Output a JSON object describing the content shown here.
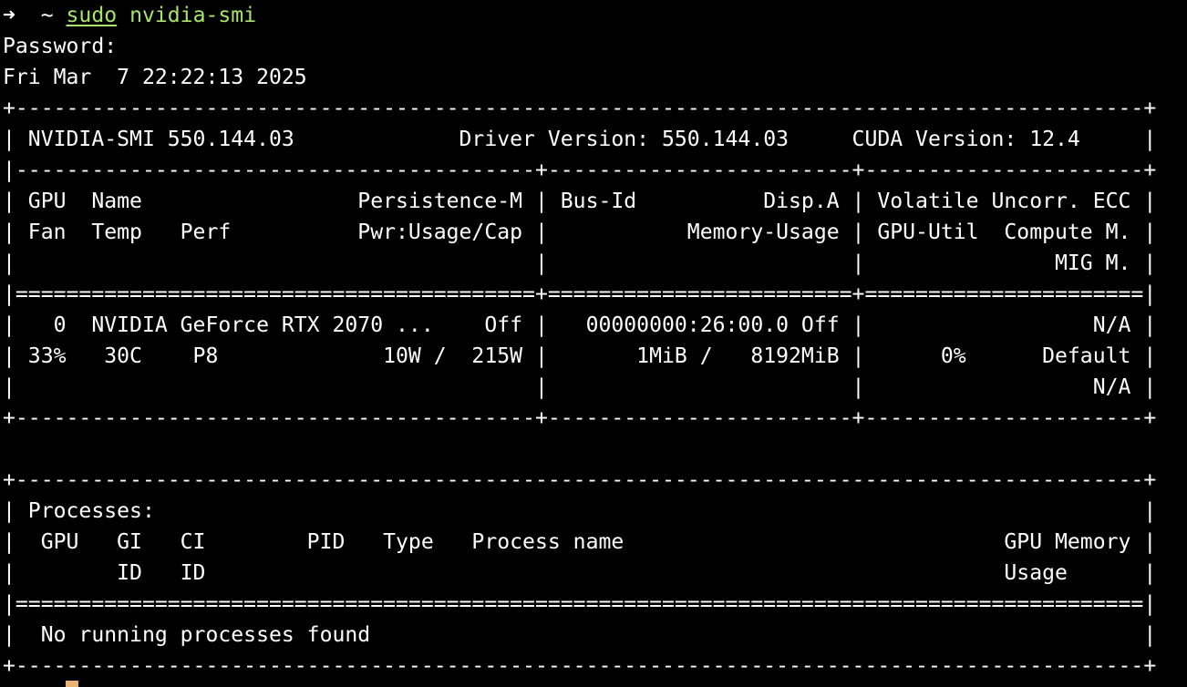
{
  "prompt": {
    "arrow": "➜",
    "dir": "~",
    "sudo": "sudo",
    "command": "nvidia-smi"
  },
  "output": [
    "Password:",
    "Fri Mar  7 22:22:13 2025",
    "+-----------------------------------------------------------------------------------------+",
    "| NVIDIA-SMI 550.144.03             Driver Version: 550.144.03     CUDA Version: 12.4     |",
    "|-----------------------------------------+------------------------+----------------------+",
    "| GPU  Name                 Persistence-M | Bus-Id          Disp.A | Volatile Uncorr. ECC |",
    "| Fan  Temp   Perf          Pwr:Usage/Cap |           Memory-Usage | GPU-Util  Compute M. |",
    "|                                         |                        |               MIG M. |",
    "|=========================================+========================+======================|",
    "|   0  NVIDIA GeForce RTX 2070 ...    Off |   00000000:26:00.0 Off |                  N/A |",
    "| 33%   30C    P8             10W /  215W |       1MiB /   8192MiB |      0%      Default |",
    "|                                         |                        |                  N/A |",
    "+-----------------------------------------+------------------------+----------------------+",
    "",
    "+-----------------------------------------------------------------------------------------+",
    "| Processes:                                                                              |",
    "|  GPU   GI   CI        PID   Type   Process name                              GPU Memory |",
    "|        ID   ID                                                               Usage      |",
    "|=========================================================================================|",
    "|  No running processes found                                                             |",
    "+-----------------------------------------------------------------------------------------+"
  ],
  "colors": {
    "background": "#000000",
    "text": "#ffffff",
    "command": "#a8e36a",
    "cursor": "#e9b36f"
  }
}
